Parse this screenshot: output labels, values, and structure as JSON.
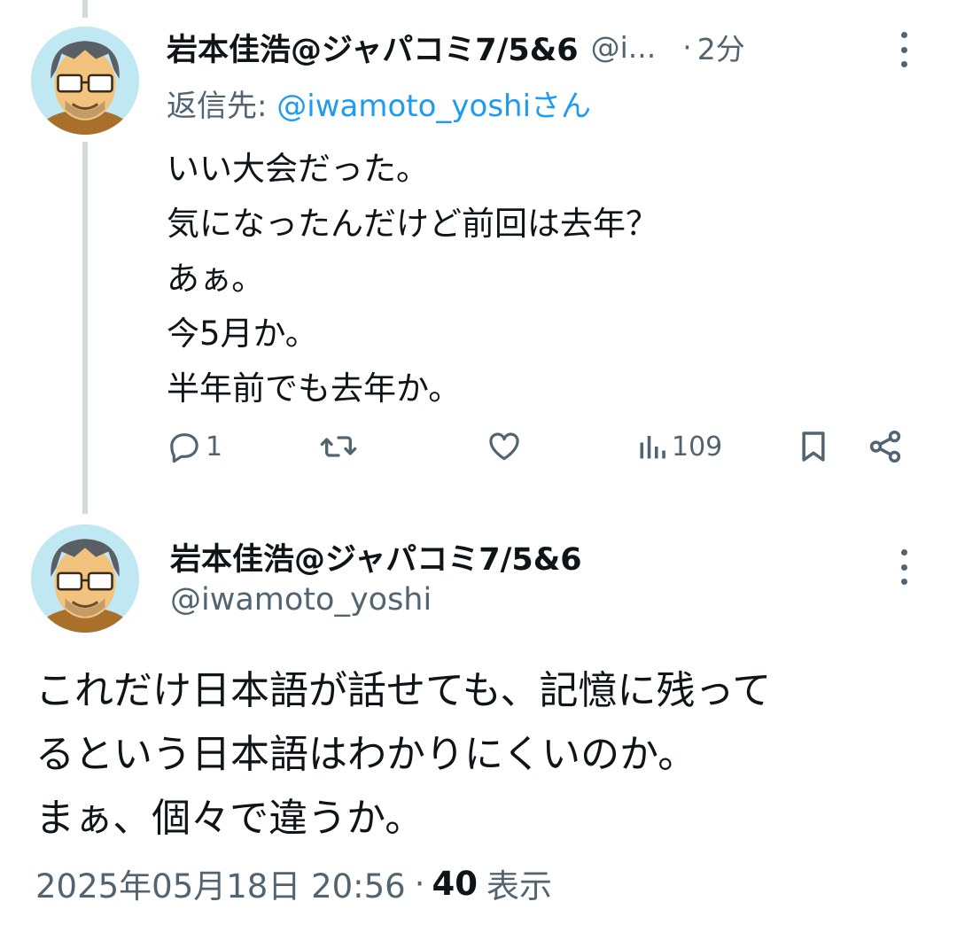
{
  "reply_tweet": {
    "display_name": "岩本佳浩@ジャパコミ7/5&6",
    "handle_truncated": "@i...",
    "separator": "·",
    "time_ago": "2分",
    "replying_label": "返信先: ",
    "replying_mention": "@iwamoto_yoshi",
    "replying_suffix": "さん",
    "body_lines": [
      "いい大会だった。",
      "気になったんだけど前回は去年？",
      "あぁ。",
      "今5月か。",
      "半年前でも去年か。"
    ],
    "actions": {
      "reply_count": "1",
      "retweet_count": "",
      "like_count": "",
      "view_count": "109"
    }
  },
  "main_tweet": {
    "display_name": "岩本佳浩@ジャパコミ7/5&6",
    "handle": "@iwamoto_yoshi",
    "body_lines": [
      "これだけ日本語が話せても、記憶に残って",
      "るという日本語はわかりにくいのか。",
      "まぁ、個々で違うか。"
    ],
    "timestamp": "2025年05月18日 20:56",
    "separator": "·",
    "views_count": "40",
    "views_label": "表示"
  },
  "icons": {
    "reply": "reply-icon",
    "retweet": "retweet-icon",
    "like": "heart-icon",
    "views": "views-chart-icon",
    "bookmark": "bookmark-icon",
    "share": "share-icon",
    "more": "more-vertical-icon"
  },
  "colors": {
    "link": "#1d9bf0",
    "secondary_text": "#536471",
    "primary_text": "#0f1419",
    "thread_line": "#cfd9de"
  }
}
